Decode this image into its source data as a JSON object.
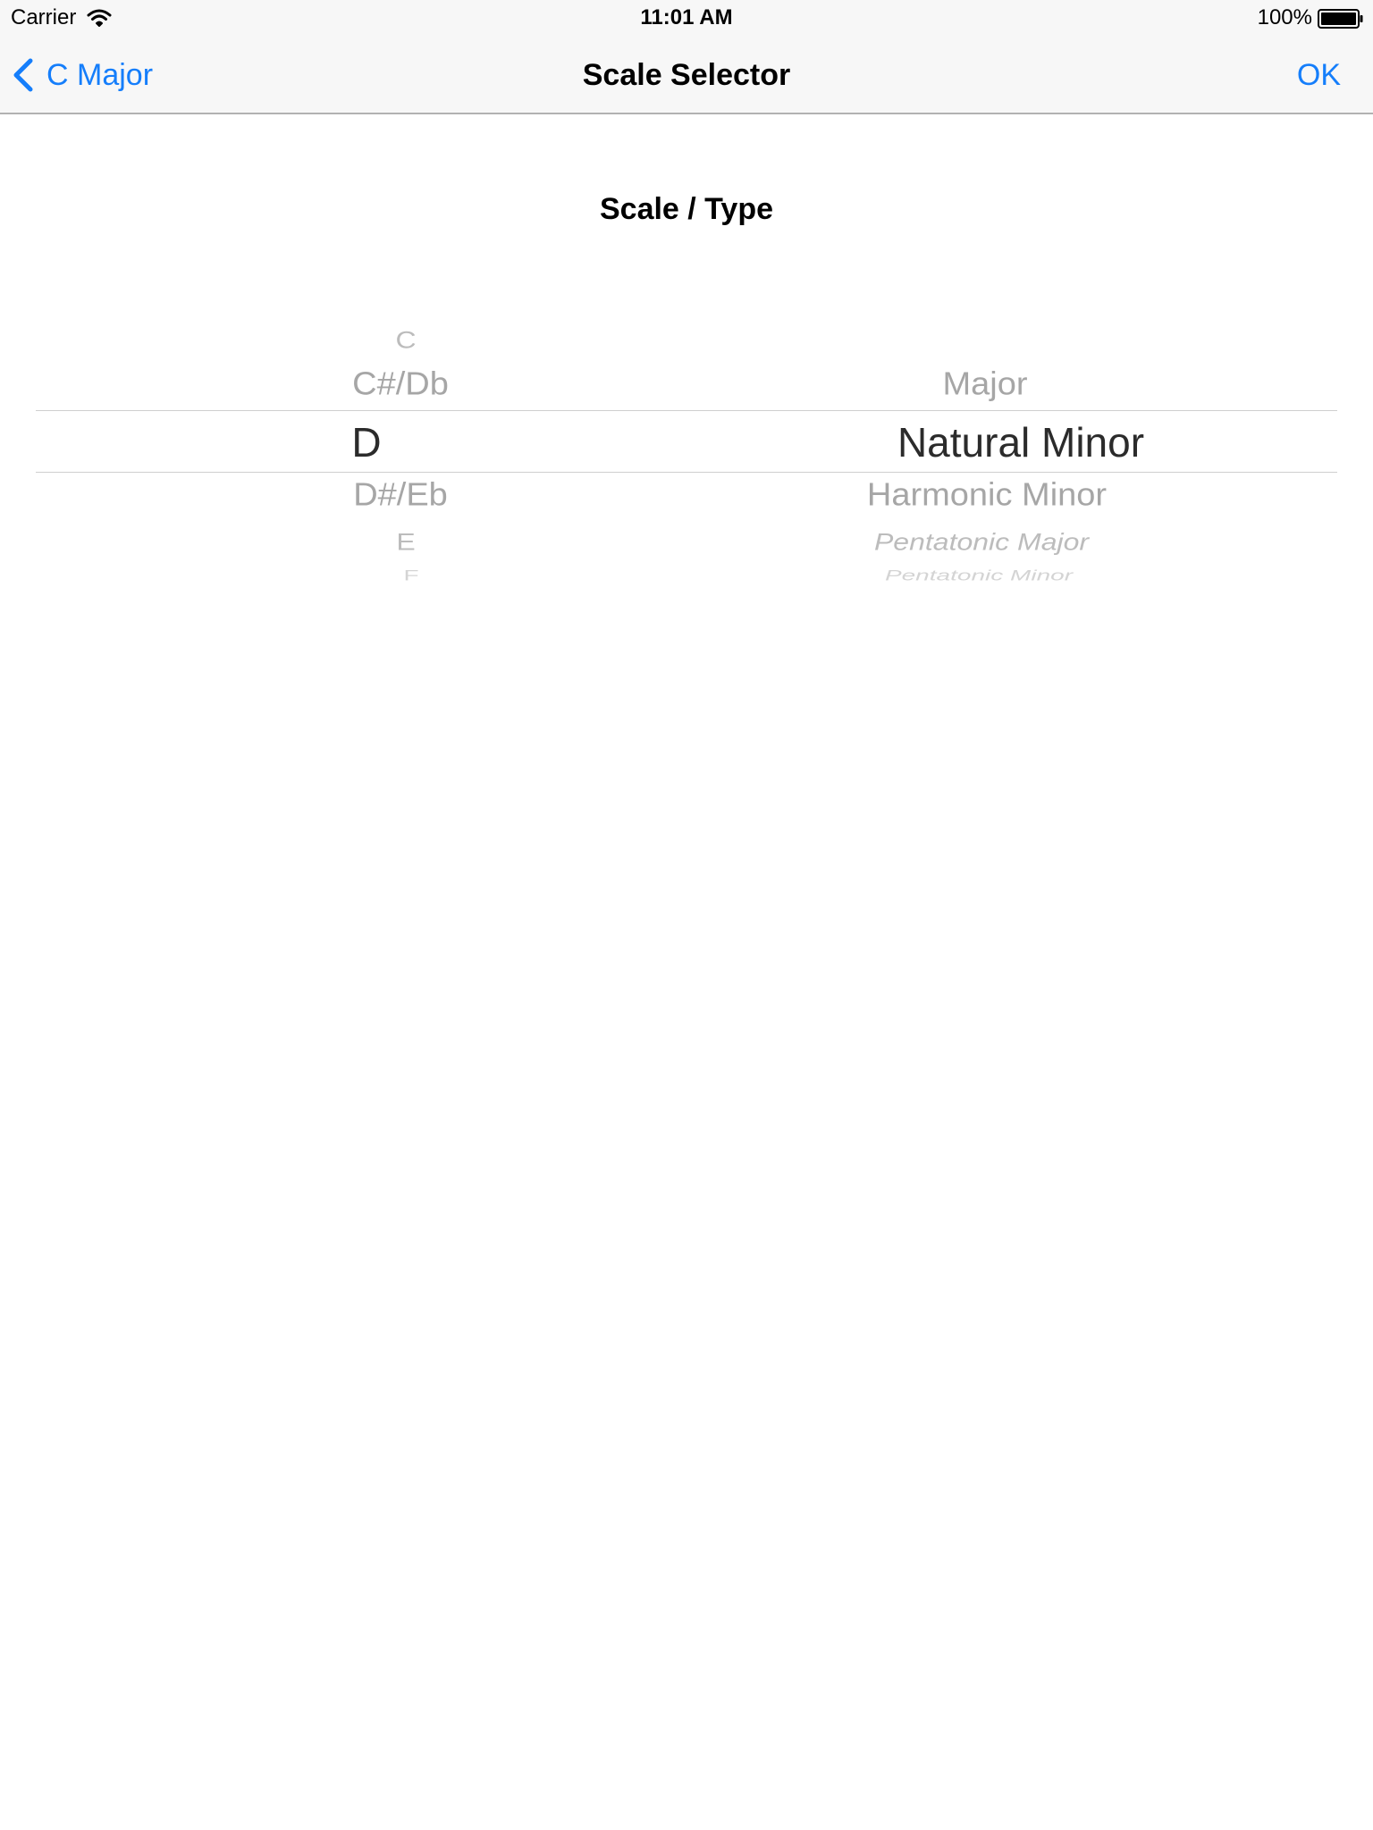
{
  "status_bar": {
    "carrier": "Carrier",
    "time": "11:01 AM",
    "battery": "100%",
    "icons": [
      "wifi-icon",
      "battery-icon"
    ]
  },
  "nav": {
    "back_label": "C Major",
    "title": "Scale Selector",
    "ok_label": "OK",
    "accent_color": "#157efb"
  },
  "section_title": "Scale / Type",
  "picker": {
    "notes": {
      "visible": [
        "C",
        "C#/Db",
        "D",
        "D#/Eb",
        "E",
        "F"
      ],
      "selected": "D"
    },
    "types": {
      "visible": [
        "Major",
        "Natural Minor",
        "Harmonic Minor",
        "Pentatonic Major",
        "Pentatonic Minor"
      ],
      "selected": "Natural Minor"
    }
  }
}
